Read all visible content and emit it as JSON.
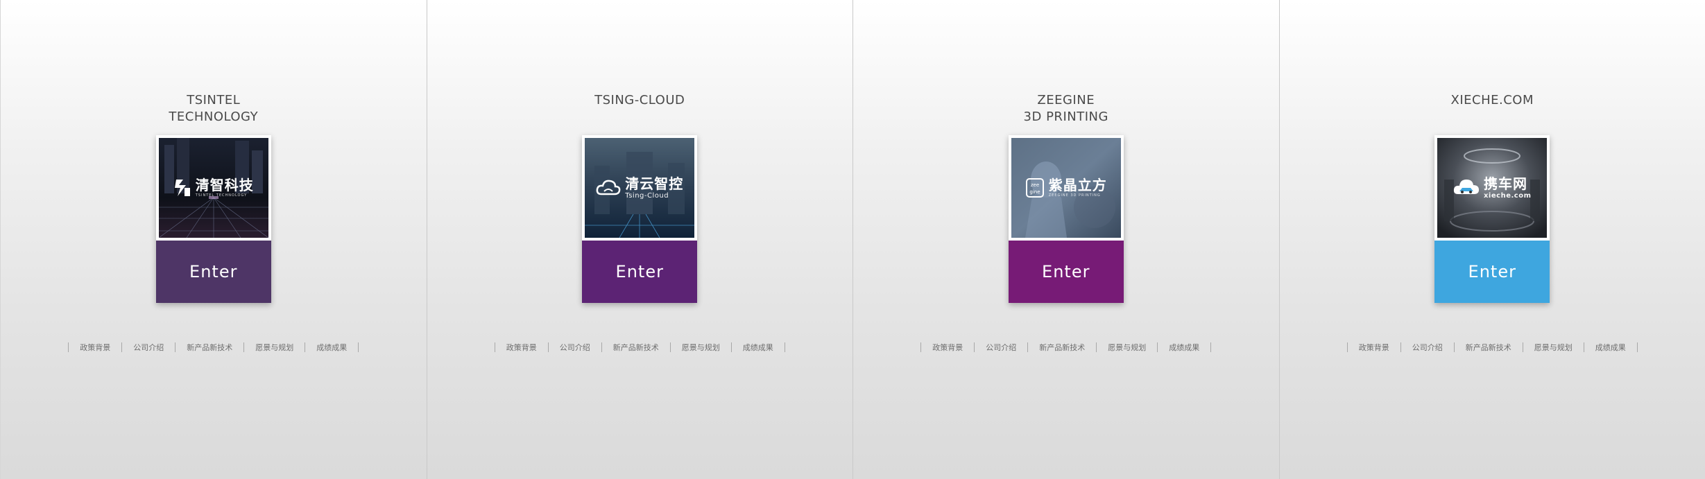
{
  "panels": [
    {
      "title_lines": [
        "TSINTEL",
        "TECHNOLOGY"
      ],
      "logo_cn": "清智科技",
      "logo_en": "TSINTEL TECHNOLOGY",
      "logo_icon": "tsintel-logo-icon",
      "enter_label": "Enter",
      "enter_color": "#4e3566",
      "nav": [
        "政策背景",
        "公司介绍",
        "新产品新技术",
        "愿景与规划",
        "成绩成果"
      ]
    },
    {
      "title_lines": [
        "TSING-CLOUD"
      ],
      "logo_cn": "清云智控",
      "logo_en": "Tsing-Cloud",
      "logo_icon": "cloud-logo-icon",
      "enter_label": "Enter",
      "enter_color": "#5c2374",
      "nav": [
        "政策背景",
        "公司介绍",
        "新产品新技术",
        "愿景与规划",
        "成绩成果"
      ]
    },
    {
      "title_lines": [
        "ZEEGINE",
        "3D PRINTING"
      ],
      "logo_cn": "紫晶立方",
      "logo_en": "ZEEGINE 3D PRINTING",
      "logo_icon": "zeegine-logo-icon",
      "enter_label": "Enter",
      "enter_color": "#771b76",
      "nav": [
        "政策背景",
        "公司介绍",
        "新产品新技术",
        "愿景与规划",
        "成绩成果"
      ]
    },
    {
      "title_lines": [
        "XIECHE.COM"
      ],
      "logo_cn": "携车网",
      "logo_en": "xieche.com",
      "logo_icon": "car-cloud-logo-icon",
      "enter_label": "Enter",
      "enter_color": "#3ea6df",
      "nav": [
        "政策背景",
        "公司介绍",
        "新产品新技术",
        "愿景与规划",
        "成绩成果"
      ]
    }
  ]
}
